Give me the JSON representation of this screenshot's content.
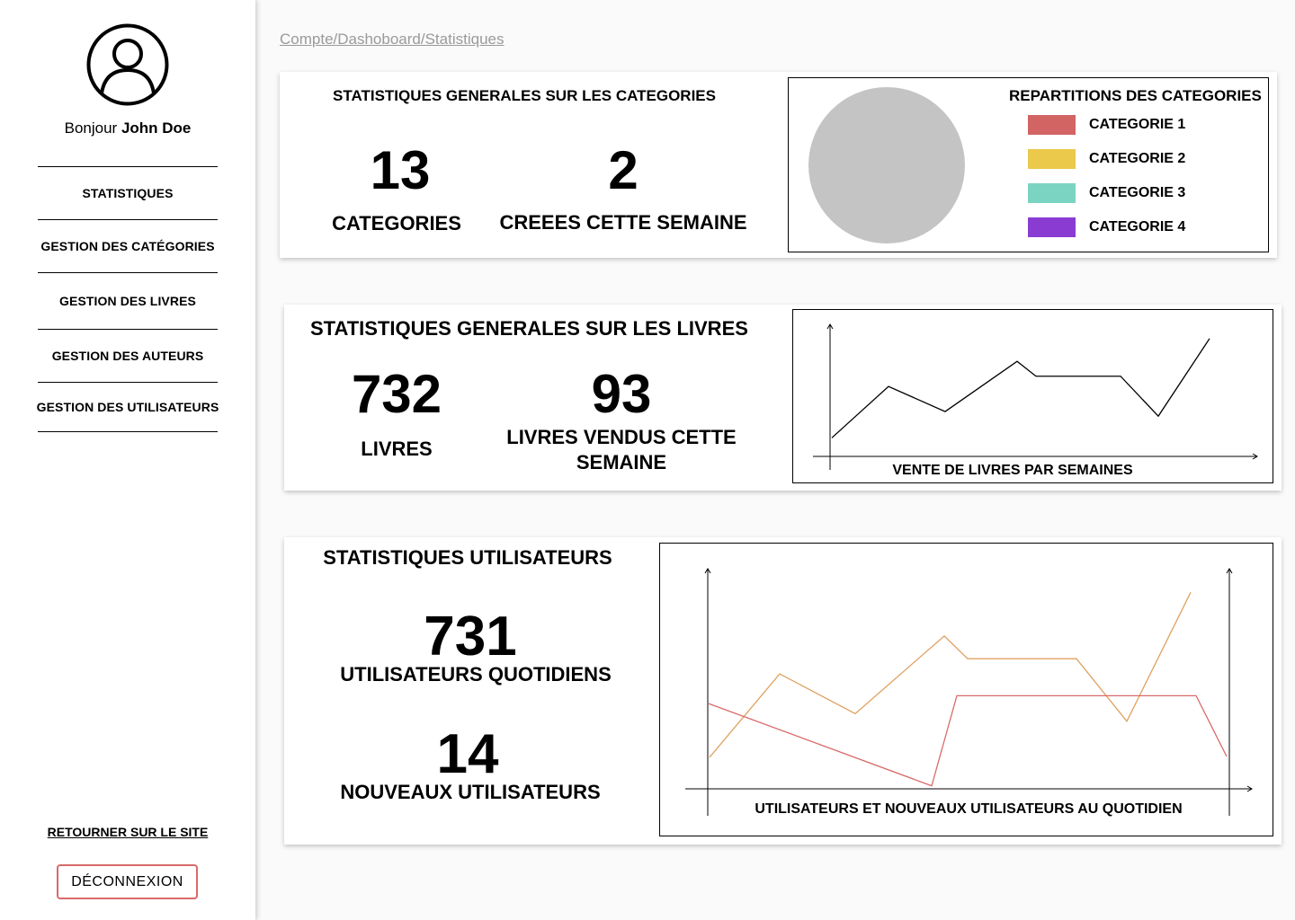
{
  "sidebar": {
    "greeting_prefix": "Bonjour ",
    "user_name": "John Doe",
    "nav": [
      {
        "label": "STATISTIQUES"
      },
      {
        "label": "GESTION DES CATÉGORIES"
      },
      {
        "label": "GESTION DES LIVRES"
      },
      {
        "label": "GESTION DES AUTEURS"
      },
      {
        "label": "GESTION DES UTILISATEURS"
      }
    ],
    "back_link": "RETOURNER SUR LE SITE",
    "logout_label": "DÉCONNEXION"
  },
  "breadcrumb": "Compte/Dashoboard/Statistiques",
  "categories_card": {
    "title": "STATISTIQUES GENERALES SUR LES CATEGORIES",
    "count": "13",
    "count_label": "CATEGORIES",
    "new_count": "2",
    "new_label": "CREEES CETTE SEMAINE",
    "legend_title": "REPARTITIONS DES CATEGORIES",
    "legend": [
      {
        "label": "CATEGORIE 1",
        "color": "#d26464"
      },
      {
        "label": "CATEGORIE 2",
        "color": "#ebc94a"
      },
      {
        "label": "CATEGORIE 3",
        "color": "#7bd3c2"
      },
      {
        "label": "CATEGORIE 4",
        "color": "#8a3cd2"
      }
    ],
    "pie_color": "#c4c4c4"
  },
  "books_card": {
    "title": "STATISTIQUES GENERALES SUR LES LIVRES",
    "count": "732",
    "count_label": "LIVRES",
    "sold_count": "93",
    "sold_label": "LIVRES VENDUS CETTE SEMAINE",
    "chart_caption": "VENTE DE LIVRES PAR SEMAINES"
  },
  "users_card": {
    "title": "STATISTIQUES UTILISATEURS",
    "daily_count": "731",
    "daily_label": "UTILISATEURS QUOTIDIENS",
    "new_count": "14",
    "new_label": "NOUVEAUX UTILISATEURS",
    "chart_caption": "UTILISATEURS ET NOUVEAUX UTILISATEURS AU QUOTIDIEN"
  },
  "chart_data": [
    {
      "type": "pie",
      "title": "REPARTITIONS DES CATEGORIES",
      "categories": [
        "CATEGORIE 1",
        "CATEGORIE 2",
        "CATEGORIE 3",
        "CATEGORIE 4"
      ],
      "values": [],
      "fill_color": "#c4c4c4",
      "legend": "right"
    },
    {
      "type": "line",
      "title": "VENTE DE LIVRES PAR SEMAINES",
      "xlabel": "",
      "ylabel": "",
      "grid": false,
      "series": [
        {
          "color": "#000000",
          "values": [
            0.1,
            0.55,
            0.33,
            0.77,
            0.64,
            0.64,
            0.29,
            0.97
          ]
        }
      ],
      "ylim": [
        0,
        1
      ]
    },
    {
      "type": "line",
      "title": "UTILISATEURS ET NOUVEAUX UTILISATEURS AU QUOTIDIEN",
      "xlabel": "",
      "ylabel": "",
      "grid": false,
      "series": [
        {
          "color": "#e0a060",
          "values": [
            0.1,
            0.54,
            0.33,
            0.74,
            0.62,
            0.62,
            0.29,
            0.97
          ]
        },
        {
          "color": "#d96a6a",
          "values": [
            0.44,
            0.02,
            0.48,
            0.48,
            0.17
          ]
        }
      ],
      "ylim": [
        0,
        1
      ]
    }
  ]
}
